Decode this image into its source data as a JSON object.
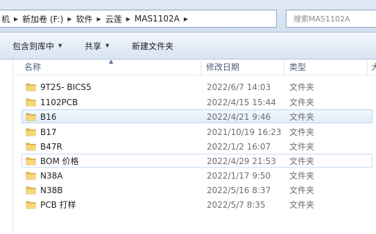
{
  "address": {
    "crumbs": [
      "机",
      "新加卷 (F:)",
      "软件",
      "云莲",
      "MAS1102A"
    ],
    "search_placeholder": "搜索MAS1102A"
  },
  "toolbar": {
    "include_label": "包含到库中",
    "share_label": "共享",
    "new_folder_label": "新建文件夹"
  },
  "columns": {
    "name": "名称",
    "date": "修改日期",
    "type": "类型",
    "size": "大"
  },
  "files": [
    {
      "name": "9T25- BICS5",
      "date": "2022/6/7 14:03",
      "type": "文件夹"
    },
    {
      "name": "1102PCB",
      "date": "2022/4/15 15:44",
      "type": "文件夹"
    },
    {
      "name": "B16",
      "date": "2022/4/21 9:46",
      "type": "文件夹"
    },
    {
      "name": "B17",
      "date": "2021/10/19 16:23",
      "type": "文件夹"
    },
    {
      "name": "B47R",
      "date": "2022/1/2 16:07",
      "type": "文件夹"
    },
    {
      "name": "BOM 价格",
      "date": "2022/4/29 21:53",
      "type": "文件夹"
    },
    {
      "name": "N38A",
      "date": "2022/1/17 9:50",
      "type": "文件夹"
    },
    {
      "name": "N38B",
      "date": "2022/5/16 8:37",
      "type": "文件夹"
    },
    {
      "name": "PCB 打样",
      "date": "2022/5/7 8:35",
      "type": "文件夹"
    }
  ]
}
